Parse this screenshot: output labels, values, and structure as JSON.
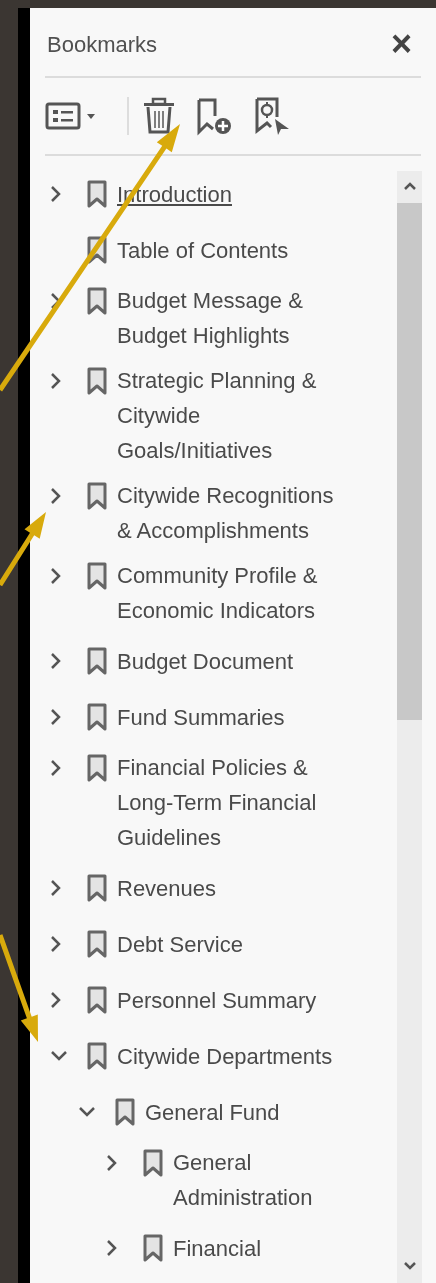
{
  "panel": {
    "title": "Bookmarks",
    "close": "×"
  },
  "toolbar": [
    {
      "kind": "options"
    },
    {
      "kind": "delete"
    },
    {
      "kind": "new"
    },
    {
      "kind": "find"
    }
  ],
  "bookmarks": [
    {
      "label": "Introduction",
      "expanded": false,
      "hovered": true
    },
    {
      "label": "Table of Contents",
      "hovered": false
    },
    {
      "label": "Budget Message & Budget Highlights",
      "expanded": false,
      "hovered": false
    },
    {
      "label": "Strategic Planning & Citywide Goals/Initiatives",
      "expanded": false,
      "hovered": false
    },
    {
      "label": "Citywide Recognitions & Accomplishments",
      "expanded": false,
      "hovered": false
    },
    {
      "label": "Community Profile & Economic Indicators",
      "expanded": false,
      "hovered": false
    },
    {
      "label": "Budget Document",
      "expanded": false,
      "hovered": false
    },
    {
      "label": "Fund Summaries",
      "expanded": false,
      "hovered": false
    },
    {
      "label": "Financial Policies & Long-Term Financial Guidelines",
      "expanded": false,
      "hovered": false
    },
    {
      "label": "Revenues",
      "expanded": false,
      "hovered": false
    },
    {
      "label": "Debt Service",
      "expanded": false,
      "hovered": false
    },
    {
      "label": "Personnel Summary",
      "expanded": false,
      "hovered": false
    },
    {
      "label": "Citywide Departments",
      "expanded": true,
      "hovered": false,
      "children": [
        {
          "label": "General Fund",
          "expanded": true,
          "hovered": false,
          "children": [
            {
              "label": "General Administration",
              "expanded": false,
              "hovered": false
            },
            {
              "label": "Financial",
              "expanded": false,
              "hovered": false
            }
          ]
        }
      ]
    }
  ]
}
